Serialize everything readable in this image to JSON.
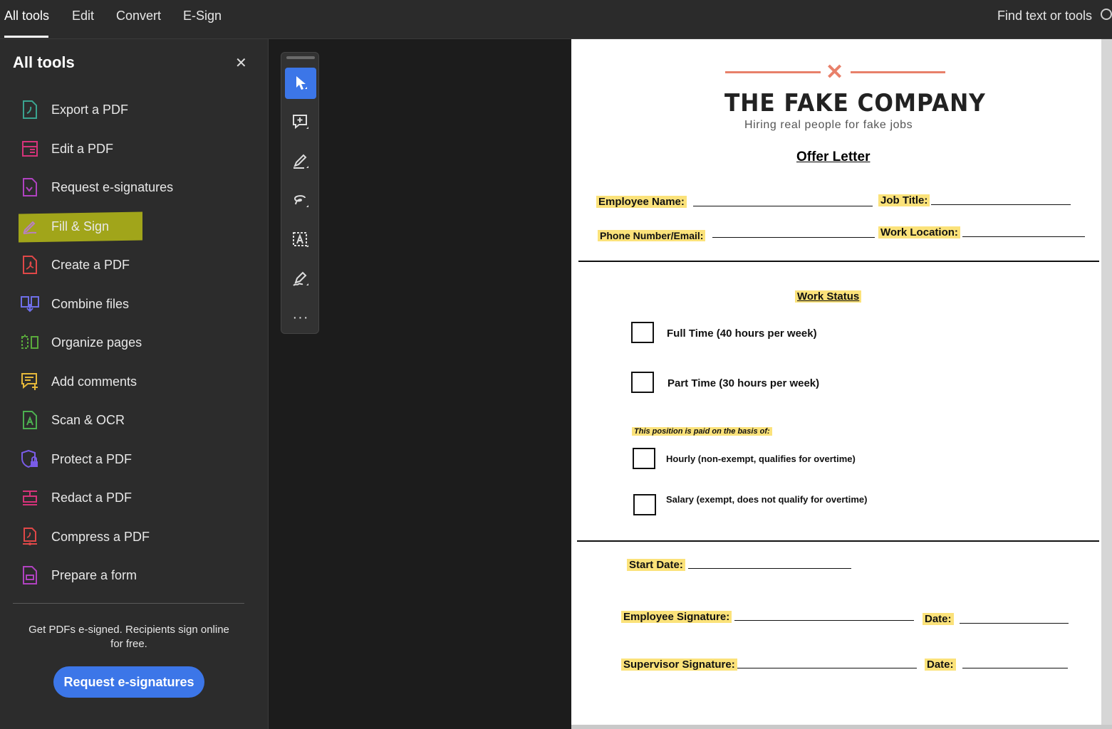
{
  "topbar": {
    "tabs": [
      {
        "label": "All tools"
      },
      {
        "label": "Edit"
      },
      {
        "label": "Convert"
      },
      {
        "label": "E-Sign"
      }
    ],
    "search_label": "Find text or tools"
  },
  "sidebar": {
    "title": "All tools",
    "close_glyph": "✕",
    "items": [
      {
        "label": "Export a PDF",
        "icon": "export-pdf-icon",
        "color": "#3aa38f"
      },
      {
        "label": "Edit a PDF",
        "icon": "edit-pdf-icon",
        "color": "#d6337a"
      },
      {
        "label": "Request e-signatures",
        "icon": "request-esign-icon",
        "color": "#b042c0"
      },
      {
        "label": "Fill & Sign",
        "icon": "fill-sign-icon",
        "color": "#b87fc4"
      },
      {
        "label": "Create a PDF",
        "icon": "create-pdf-icon",
        "color": "#e04848"
      },
      {
        "label": "Combine files",
        "icon": "combine-files-icon",
        "color": "#6f6fe8"
      },
      {
        "label": "Organize pages",
        "icon": "organize-pages-icon",
        "color": "#5aaa3c"
      },
      {
        "label": "Add comments",
        "icon": "add-comments-icon",
        "color": "#e5b83a"
      },
      {
        "label": "Scan & OCR",
        "icon": "scan-ocr-icon",
        "color": "#4caf50"
      },
      {
        "label": "Protect a PDF",
        "icon": "protect-pdf-icon",
        "color": "#7a5ce8"
      },
      {
        "label": "Redact a PDF",
        "icon": "redact-pdf-icon",
        "color": "#d6337a"
      },
      {
        "label": "Compress a PDF",
        "icon": "compress-pdf-icon",
        "color": "#e04848"
      },
      {
        "label": "Prepare a form",
        "icon": "prepare-form-icon",
        "color": "#b042c0"
      }
    ],
    "promo_text": "Get PDFs e-signed. Recipients sign online for free.",
    "promo_button": "Request e-signatures"
  },
  "vertical_toolbar": {
    "tools": [
      "select-cursor-icon",
      "add-comment-icon",
      "highlight-pen-icon",
      "freehand-draw-icon",
      "text-box-icon",
      "sign-icon",
      "more-tools-icon"
    ],
    "more_glyph": "···"
  },
  "document": {
    "logo_mark": "✕",
    "company": "THE FAKE COMPANY",
    "tagline": "Hiring real people for fake jobs",
    "title": "Offer Letter",
    "fields": {
      "employee_name": "Employee Name:",
      "job_title": "Job Title:",
      "phone_email": "Phone Number/Email:",
      "work_location": "Work Location:"
    },
    "work_status_heading": "Work Status",
    "work_status_options": [
      "Full Time (40 hours per week)",
      "Part Time (30 hours per week)"
    ],
    "pay_basis_heading": "This position is paid on the basis of:",
    "pay_basis_options": [
      "Hourly (non-exempt, qualifies for overtime)",
      "Salary (exempt, does not qualify for overtime)"
    ],
    "start_date": "Start Date:",
    "employee_signature": "Employee Signature:",
    "supervisor_signature": "Supervisor Signature:",
    "date_label": "Date:"
  },
  "colors": {
    "accent": "#3c76e8",
    "highlight": "#fbe27a",
    "logo": "#e8806a"
  }
}
